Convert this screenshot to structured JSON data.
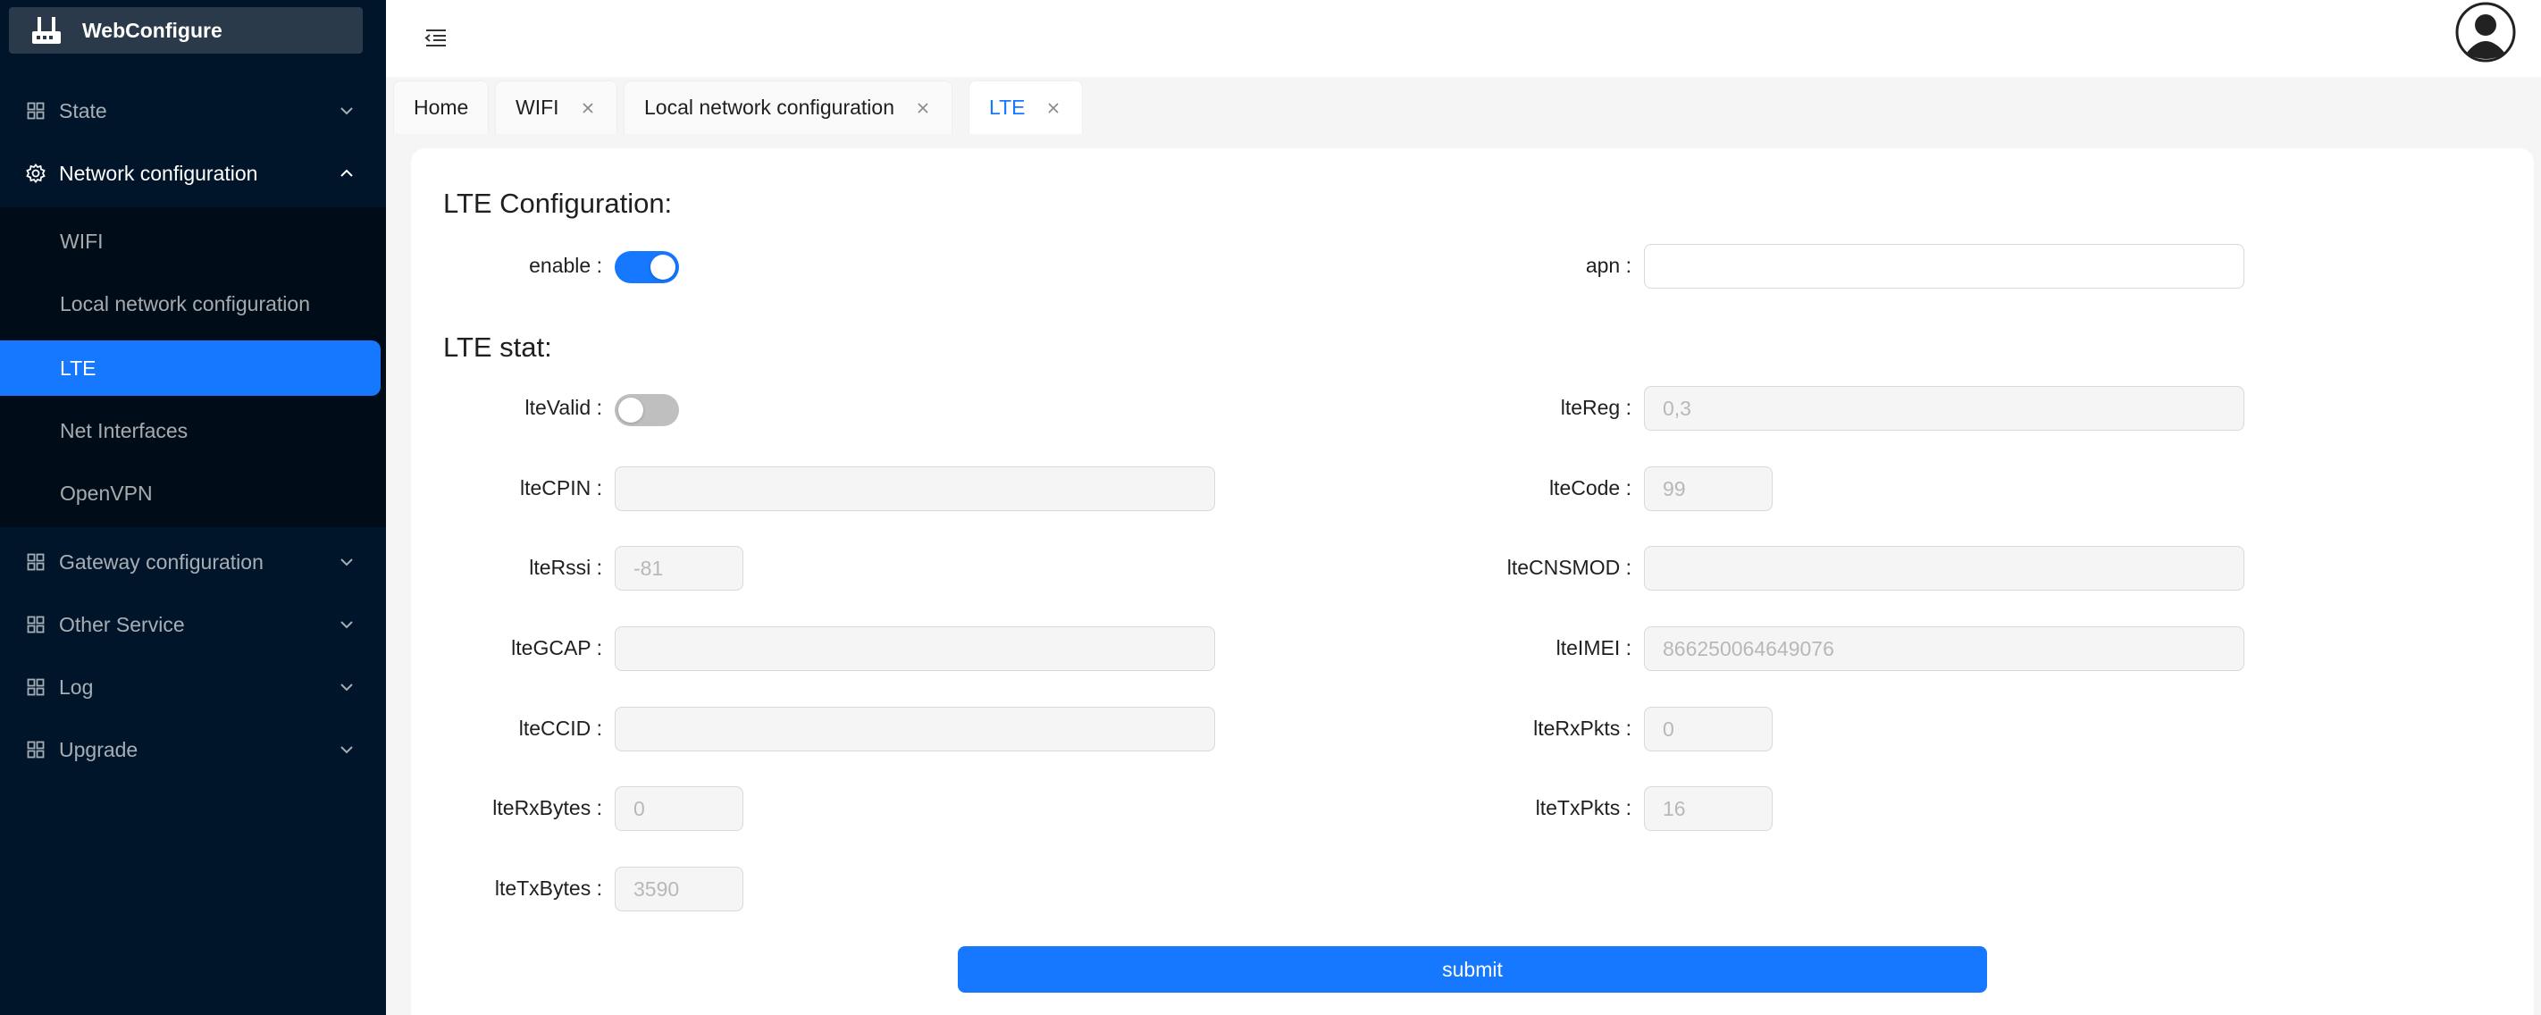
{
  "brand": {
    "name": "WebConfigure",
    "icon": "router-icon"
  },
  "menu": {
    "state": "State",
    "network": "Network configuration",
    "network_sub": [
      "WIFI",
      "Local network configuration",
      "LTE",
      "Net Interfaces",
      "OpenVPN"
    ],
    "gateway": "Gateway configuration",
    "other": "Other Service",
    "log": "Log",
    "upgrade": "Upgrade"
  },
  "tabs": [
    "Home",
    "WIFI",
    "Local network configuration",
    "LTE"
  ],
  "form": {
    "config_title": "LTE Configuration:",
    "enable_label": "enable",
    "enable_on": true,
    "apn_label": "apn",
    "apn_value": "",
    "stat_title": "LTE stat:",
    "lteValid_label": "lteValid",
    "lteValid_on": false,
    "lteReg_label": "lteReg",
    "lteReg_value": "0,3",
    "lteCPIN_label": "lteCPIN",
    "lteCPIN_value": "",
    "lteCode_label": "lteCode",
    "lteCode_value": "99",
    "lteRssi_label": "lteRssi",
    "lteRssi_value": "-81",
    "lteCNSMOD_label": "lteCNSMOD",
    "lteCNSMOD_value": "",
    "lteGCAP_label": "lteGCAP",
    "lteGCAP_value": "",
    "lteIMEI_label": "lteIMEI",
    "lteIMEI_value": "866250064649076",
    "lteCCID_label": "lteCCID",
    "lteCCID_value": "",
    "lteRxPkts_label": "lteRxPkts",
    "lteRxPkts_value": "0",
    "lteRxBytes_label": "lteRxBytes",
    "lteRxBytes_value": "0",
    "lteTxPkts_label": "lteTxPkts",
    "lteTxPkts_value": "16",
    "lteTxBytes_label": "lteTxBytes",
    "lteTxBytes_value": "3590",
    "colon": ":",
    "submit": "submit"
  },
  "colors": {
    "primary": "#1677ff",
    "sidebar": "#001529",
    "submenu": "#000c17"
  }
}
